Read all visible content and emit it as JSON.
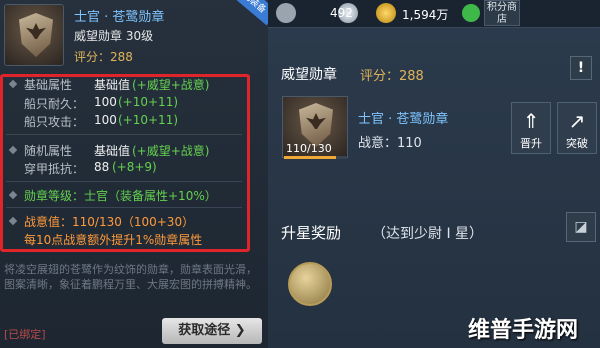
{
  "item": {
    "name": "士官 · 苍鹭勋章",
    "type_level": "威望勋章    30级",
    "score": "评分：288",
    "ribbon": "已装备"
  },
  "attributes": {
    "base_label": "基础属性",
    "base_value_label": "基础值",
    "base_value_formula": "(+威望+战意)",
    "ship_dur_label": "船只耐久：",
    "ship_dur_base": "100",
    "ship_dur_bonus": "(+10+11)",
    "ship_atk_label": "船只攻击：",
    "ship_atk_base": "100",
    "ship_atk_bonus": "(+10+11)",
    "random_label": "随机属性",
    "random_value_label": "基础值",
    "random_value_formula": "(+威望+战意)",
    "armor_label": "穿甲抵抗：",
    "armor_base": "88",
    "armor_bonus": "(+8+9)",
    "rank_line": "勋章等级：士官（装备属性+10%）",
    "war_line": "战意值：110/130（100+30）",
    "war_note": "每10点战意额外提升1%勋章属性"
  },
  "description": "将凌空展翅的苍鹭作为纹饰的勋章，勋章表面光滑，图案清晰，象征着鹏程万里、大展宏图的拼搏精神。",
  "bound": "[已绑定]",
  "get_button": "获取途径 ❯",
  "topbar": {
    "value1": "492",
    "value2": "1,594万",
    "shop": "积分商店"
  },
  "panel": {
    "title": "威望勋章",
    "score": "评分：288",
    "exclaim": "!",
    "medal_name": "士官 · 苍鹭勋章",
    "war": "战意：110",
    "fraction": "110/130",
    "progress": 0.846,
    "promote": "晋升",
    "breakthrough": "突破",
    "star_title": "升星奖励",
    "star_cond": "（达到少尉 I 星）"
  },
  "watermark": "维普手游网"
}
